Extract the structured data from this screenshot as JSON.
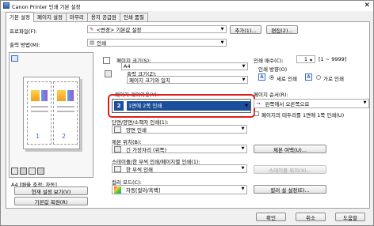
{
  "window": {
    "title": "Canon Printer 인쇄 기본 설정",
    "close": "✕"
  },
  "tabs": [
    "기본 설정",
    "페이지 설정",
    "마무리",
    "용지 공급원",
    "인쇄 품질"
  ],
  "profile": {
    "label": "프로파일(F):",
    "value": "<변경> 기본값 설정",
    "add": "추가(1)...",
    "edit": "편집(2)..."
  },
  "output": {
    "label": "출력 방법(M):",
    "value": "인쇄"
  },
  "preview": {
    "caption": "A4 [배율 조정: 자동]",
    "view_btn": "현재 설정 보기(V)",
    "restore_btn": "기본값 복원(R)",
    "nums": [
      "1",
      "2"
    ]
  },
  "page_size": {
    "label": "페이지 크기(S):",
    "value": "A4"
  },
  "output_size": {
    "label": "출력 크기(Z):",
    "value": "페이지 크기와 일치"
  },
  "layout": {
    "label": "페이지 레이아웃(Y):",
    "badge": "2",
    "value": "1면에 2쪽 인쇄"
  },
  "duplex": {
    "label": "단면/양면/소책자 인쇄(1):",
    "value": "양면 인쇄"
  },
  "binding": {
    "label": "제본 위치(B):",
    "value": "긴 가장자리 (위쪽)"
  },
  "staple": {
    "label": "스테이플/한 부씩 인쇄/페이지별 인쇄(1):",
    "value": "한 부씩 인쇄"
  },
  "color": {
    "label": "컬러 모드(C):",
    "value": "자동[컬러/흑백]"
  },
  "copies": {
    "label": "인쇄 매수(C):",
    "value": "1",
    "range": "[1 ~ 9999]"
  },
  "orientation": {
    "label": "인쇄 방향(O)",
    "portrait": "세로 인쇄",
    "landscape": "가로 인쇄",
    "selected": "portrait"
  },
  "page_order": {
    "label": "페이지 순서(R):",
    "value": "왼쪽에서 오른쪽으로"
  },
  "border": {
    "label": "페이지의 테두리를 1면에 1쪽 인쇄(U)"
  },
  "buttons": {
    "binding_details": "제본 여백(U)...",
    "staple_pos": "스테이플 위치(X)...",
    "color_settings": "컬러 설 설정(E)...",
    "ok": "확인",
    "cancel": "취소",
    "help": "도움말"
  },
  "colors": {
    "highlight": "#e01d1d",
    "badge": "#1b4f9c"
  }
}
